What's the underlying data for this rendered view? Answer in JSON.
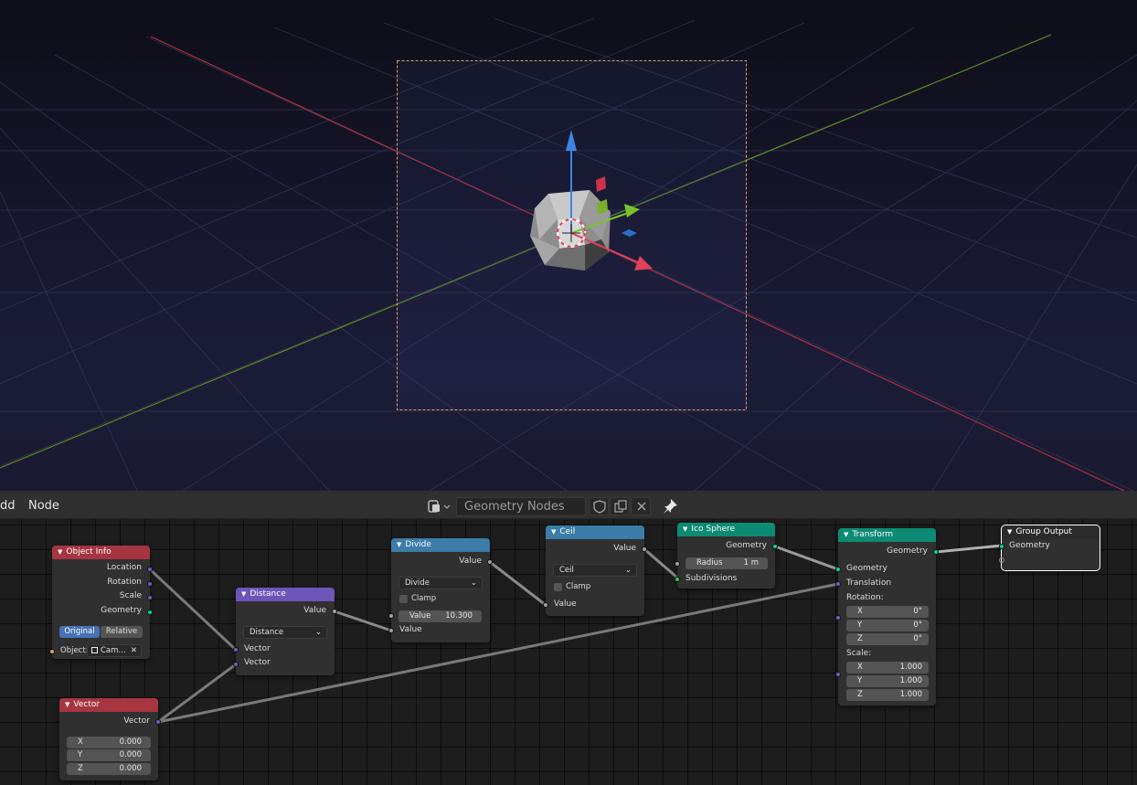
{
  "header": {
    "menu": [
      "dd",
      "Node"
    ],
    "node_tree_name": "Geometry Nodes"
  },
  "nodes": {
    "object_info": {
      "title": "Object Info",
      "outputs": [
        "Location",
        "Rotation",
        "Scale",
        "Geometry"
      ],
      "mode_options": [
        "Original",
        "Relative"
      ],
      "object_label": "Object:",
      "object_value": "Cam..."
    },
    "distance": {
      "title": "Distance",
      "output": "Value",
      "operation": "Distance",
      "inputs": [
        "Vector",
        "Vector"
      ]
    },
    "divide": {
      "title": "Divide",
      "output": "Value",
      "operation": "Divide",
      "clamp": "Clamp",
      "value_label": "Value",
      "value": "10.300",
      "input": "Value"
    },
    "ceil": {
      "title": "Ceil",
      "output": "Value",
      "operation": "Ceil",
      "clamp": "Clamp",
      "input": "Value"
    },
    "ico_sphere": {
      "title": "Ico Sphere",
      "output": "Geometry",
      "radius_label": "Radius",
      "radius": "1 m",
      "subdivisions": "Subdivisions"
    },
    "transform": {
      "title": "Transform",
      "output": "Geometry",
      "inputs": [
        "Geometry",
        "Translation"
      ],
      "rotation_label": "Rotation:",
      "rotation": [
        {
          "axis": "X",
          "value": "0°"
        },
        {
          "axis": "Y",
          "value": "0°"
        },
        {
          "axis": "Z",
          "value": "0°"
        }
      ],
      "scale_label": "Scale:",
      "scale": [
        {
          "axis": "X",
          "value": "1.000"
        },
        {
          "axis": "Y",
          "value": "1.000"
        },
        {
          "axis": "Z",
          "value": "1.000"
        }
      ]
    },
    "group_output": {
      "title": "Group Output",
      "input": "Geometry"
    },
    "vector": {
      "title": "Vector",
      "output": "Vector",
      "values": [
        {
          "axis": "X",
          "value": "0.000"
        },
        {
          "axis": "Y",
          "value": "0.000"
        },
        {
          "axis": "Z",
          "value": "0.000"
        }
      ]
    }
  },
  "colors": {
    "input_header": "#a63540",
    "vector_header": "#6b55b8",
    "converter_header": "#3b7ca8",
    "geometry_header": "#0d8a72",
    "output_header": "#2b2b2b",
    "vector_socket": "#6363c7",
    "float_socket": "#a1a1a1",
    "geometry_socket": "#00d6a3",
    "int_socket": "#36c94a",
    "object_socket": "#ed9e5c"
  }
}
